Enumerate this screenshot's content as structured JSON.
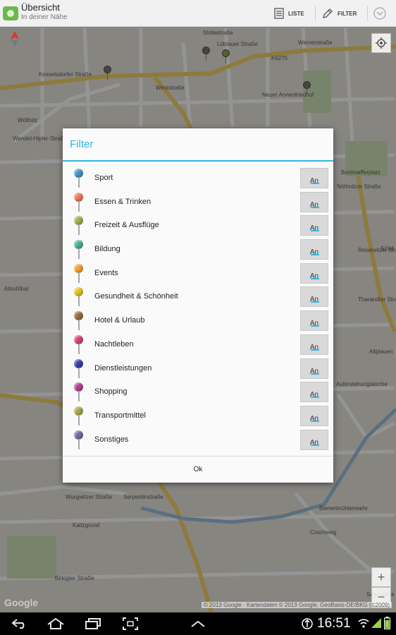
{
  "action_bar": {
    "title": "Übersicht",
    "subtitle": "In deiner Nähe",
    "list_label": "LISTE",
    "filter_label": "FILTER"
  },
  "map": {
    "streets": [
      "Stollestraße",
      "Kesselsdorfer Straße",
      "Wernerstraße",
      "Löbtauer Straße",
      "Weststraße",
      "Wölfnitz",
      "Wendel-Hipler-Straße",
      "Altroßthal",
      "Neuer Annenfriedhof",
      "Bonhoefferplatz",
      "Nöthnitzer Straße",
      "Reisewitzer Straße",
      "Tharandter Straße",
      "Altplauen",
      "Auferstehungskirche",
      "Wurgwitzer Straße",
      "Serpentinstraße",
      "Kaitzgrund",
      "Birkigter Straße",
      "Bienertmühlenwehr",
      "Coschweg",
      "Saarstraße",
      "K6275",
      "S194"
    ],
    "attribution": "© 2013 Google · Kartendaten © 2013 Google, GeoBasis-DE/BKG (©2009)",
    "logo": "Google",
    "zoom_in": "+",
    "zoom_out": "−"
  },
  "dialog": {
    "title": "Filter",
    "filters": [
      {
        "label": "Sport",
        "state": "An",
        "pin_color": "#3f97c7"
      },
      {
        "label": "Essen & Trinken",
        "state": "An",
        "pin_color": "#ea7b53"
      },
      {
        "label": "Freizeit & Ausflüge",
        "state": "An",
        "pin_color": "#9fb04c"
      },
      {
        "label": "Bildung",
        "state": "An",
        "pin_color": "#4caf99"
      },
      {
        "label": "Events",
        "state": "An",
        "pin_color": "#f0a033"
      },
      {
        "label": "Gesundheit & Schönheit",
        "state": "An",
        "pin_color": "#e3c21d"
      },
      {
        "label": "Hotel & Urlaub",
        "state": "An",
        "pin_color": "#9a6a3a"
      },
      {
        "label": "Nachtleben",
        "state": "An",
        "pin_color": "#d5466d"
      },
      {
        "label": "Dienstleistungen",
        "state": "An",
        "pin_color": "#3a3fa8"
      },
      {
        "label": "Shopping",
        "state": "An",
        "pin_color": "#b03f8f"
      },
      {
        "label": "Transportmittel",
        "state": "An",
        "pin_color": "#a8a84a"
      },
      {
        "label": "Sonstiges",
        "state": "An",
        "pin_color": "#7a66a6"
      }
    ],
    "ok_label": "Ok"
  },
  "system_bar": {
    "time": "16:51"
  }
}
